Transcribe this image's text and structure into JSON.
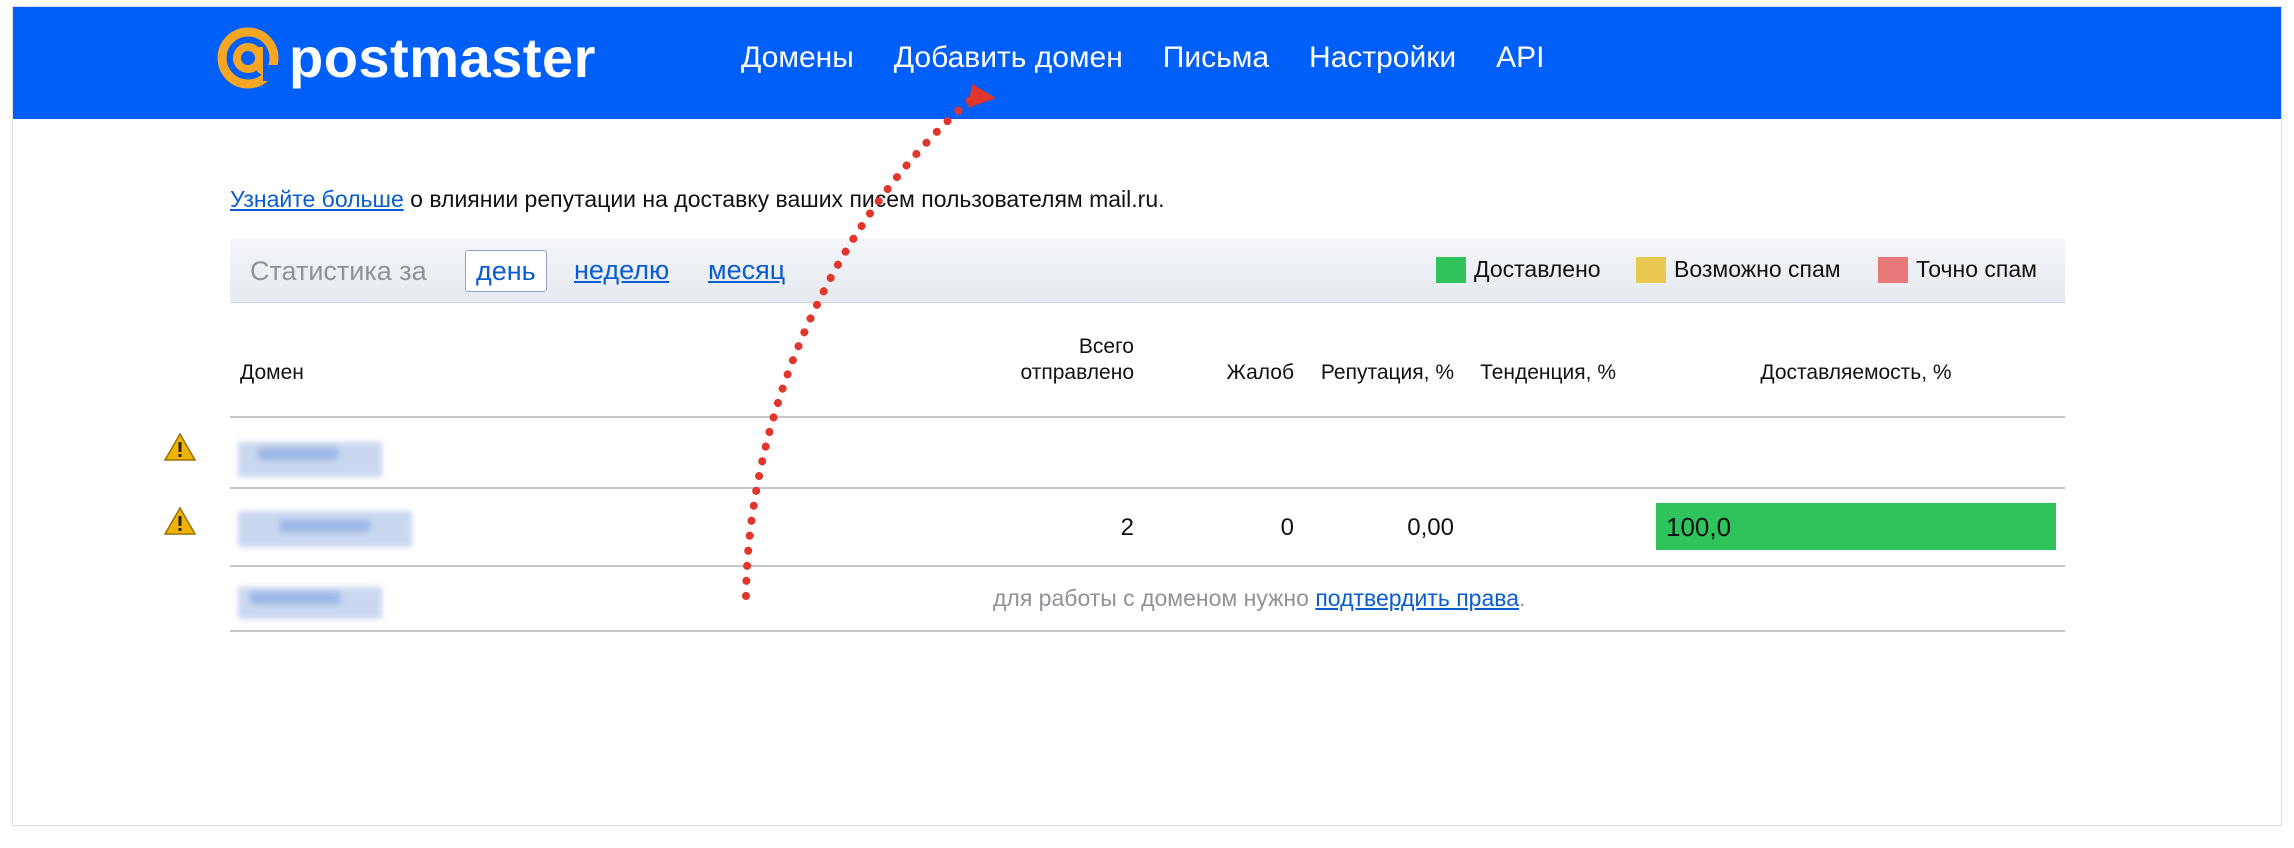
{
  "header": {
    "logo_text": "postmaster",
    "nav": [
      "Домены",
      "Добавить домен",
      "Письма",
      "Настройки",
      "API"
    ]
  },
  "info": {
    "link_text": "Узнайте больше",
    "text": " о влиянии репутации на доставку ваших писем пользователям mail.ru."
  },
  "stats": {
    "label": "Статистика за",
    "periods": [
      "день",
      "неделю",
      "месяц"
    ],
    "active_period": "день"
  },
  "legend": [
    {
      "label": "Доставлено",
      "color": "#2fc45b"
    },
    {
      "label": "Возможно спам",
      "color": "#eac951"
    },
    {
      "label": "Точно спам",
      "color": "#e97979"
    }
  ],
  "table": {
    "columns": {
      "domain": "Домен",
      "sent_line1": "Всего",
      "sent_line2": "отправлено",
      "complaints": "Жалоб",
      "reputation": "Репутация, %",
      "trend": "Тенденция, %",
      "deliverability": "Доставляемость, %"
    },
    "rows": [
      {
        "warning": true
      },
      {
        "warning": true,
        "sent": "2",
        "complaints": "0",
        "reputation": "0,00",
        "deliverability": "100,0",
        "deliverability_pct": 100
      },
      {
        "warning": false
      }
    ],
    "note_text": "для работы с доменом нужно ",
    "note_link": "подтвердить права",
    "note_end": "."
  },
  "colors": {
    "header_bg": "#005ff9",
    "logo_accent": "#f6a623",
    "arrow": "#e0362b"
  }
}
